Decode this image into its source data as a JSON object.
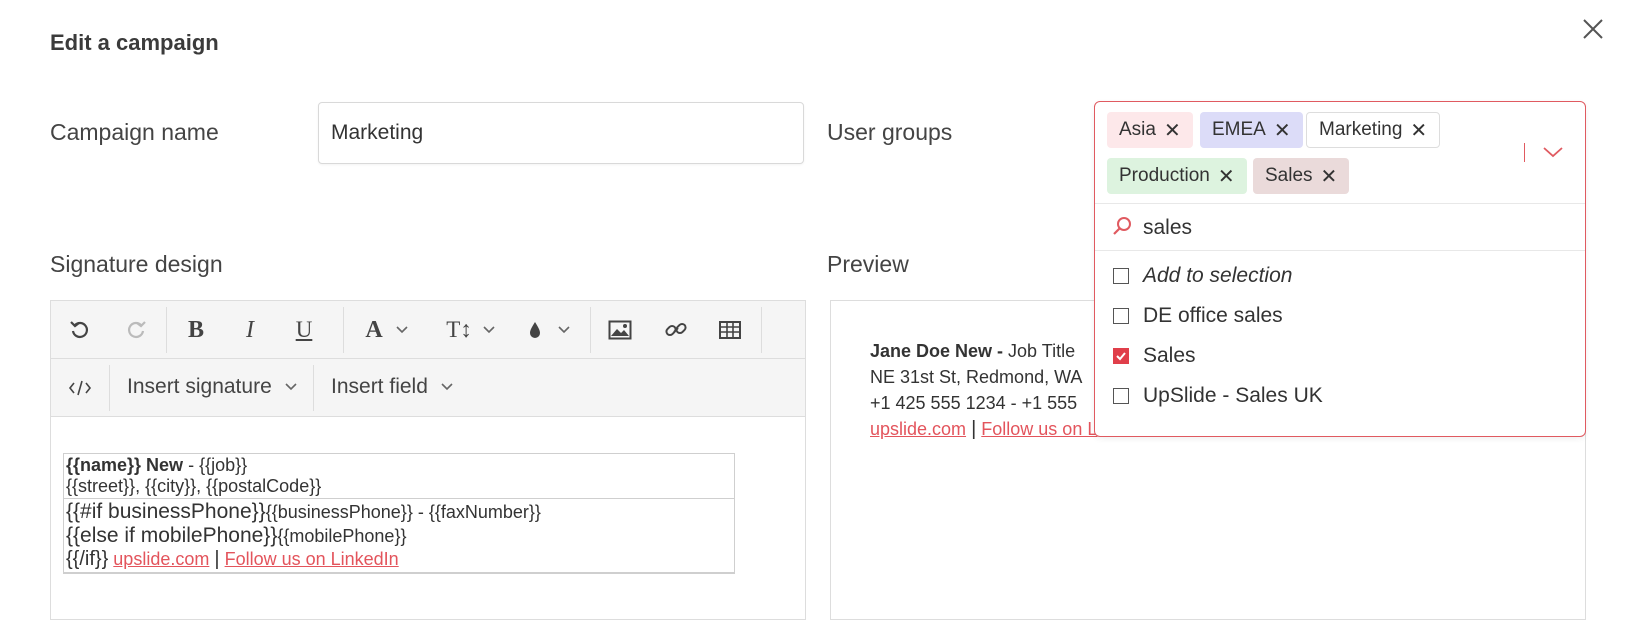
{
  "dialog": {
    "title": "Edit a campaign"
  },
  "campaign": {
    "label": "Campaign name",
    "value": "Marketing"
  },
  "user_groups": {
    "label": "User groups",
    "chips": [
      {
        "label": "Asia",
        "color": "#fde8ea"
      },
      {
        "label": "EMEA",
        "color": "#dcdcf8"
      },
      {
        "label": "Marketing",
        "color": "#ffffff"
      },
      {
        "label": "Production",
        "color": "#ddf3df"
      },
      {
        "label": "Sales",
        "color": "#eadada"
      }
    ],
    "search_value": "sales",
    "options": [
      {
        "label": "Add to selection",
        "checked": false,
        "italic": true
      },
      {
        "label": "DE office sales",
        "checked": false
      },
      {
        "label": "Sales",
        "checked": true
      },
      {
        "label": "UpSlide - Sales UK",
        "checked": false
      }
    ],
    "accent": "#e05a60"
  },
  "signature": {
    "label": "Signature design",
    "toolbar": {
      "insert_signature": "Insert signature",
      "insert_field": "Insert field"
    },
    "template": {
      "name_tag": "{{name}}",
      "name_suffix": " New",
      "dash": " - ",
      "job": "{{job}}",
      "address": "{{street}}, {{city}}, {{postalCode}}",
      "if_business": "{{#if businessPhone}}",
      "business_phone": "{{businessPhone}}",
      "fax": " - {{faxNumber}}",
      "else_mobile": "{{else if mobilePhone}}",
      "mobile_phone": "{{mobilePhone}}",
      "endif": "{{/if}}",
      "website": "upslide.com",
      "sep": "|",
      "follow": "Follow us on LinkedIn"
    }
  },
  "preview": {
    "label": "Preview",
    "name": "Jane Doe New",
    "dash": " - ",
    "job": "Job Title",
    "address": "NE 31st St, Redmond, WA",
    "phones": "+1 425 555 1234 - +1 555",
    "website": "upslide.com",
    "sep": "|",
    "follow": "Follow us on L"
  }
}
